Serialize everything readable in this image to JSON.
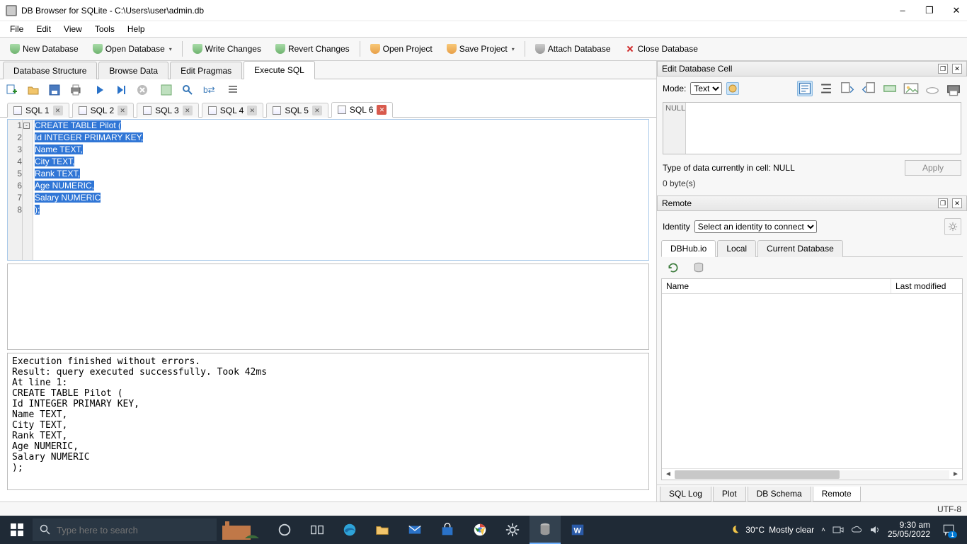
{
  "window": {
    "title": "DB Browser for SQLite - C:\\Users\\user\\admin.db"
  },
  "menu": {
    "file": "File",
    "edit": "Edit",
    "view": "View",
    "tools": "Tools",
    "help": "Help"
  },
  "toolbar": {
    "new_db": "New Database",
    "open_db": "Open Database",
    "write": "Write Changes",
    "revert": "Revert Changes",
    "open_project": "Open Project",
    "save_project": "Save Project",
    "attach": "Attach Database",
    "close": "Close Database"
  },
  "main_tabs": {
    "structure": "Database Structure",
    "browse": "Browse Data",
    "pragmas": "Edit Pragmas",
    "execute": "Execute SQL"
  },
  "sql_tabs": [
    "SQL 1",
    "SQL 2",
    "SQL 3",
    "SQL 4",
    "SQL 5",
    "SQL 6"
  ],
  "editor": {
    "line_numbers": [
      "1",
      "2",
      "3",
      "4",
      "5",
      "6",
      "7",
      "8"
    ],
    "lines_html": [
      "<span class='s-kw'>CREATE</span> <span class='s-kw'>TABLE</span> <span class='s-id'>Pilot</span> <span class='s-pu'>(</span>",
      "<span class='s-id'>Id</span> <span class='s-ty'>INTEGER</span> <span class='s-kw'>PRIMARY</span> <span class='s-kw'>KEY</span><span class='s-pu'>,</span>",
      "<span class='s-id'>Name</span> <span class='s-ty'>TEXT</span><span class='s-pu'>,</span>",
      "<span class='s-id'>City</span> <span class='s-ty'>TEXT</span><span class='s-pu'>,</span>",
      "<span class='s-id'>Rank</span> <span class='s-ty'>TEXT</span><span class='s-pu'>,</span>",
      "<span class='s-id'>Age</span> <span class='s-ty'>NUMERIC</span><span class='s-pu'>,</span>",
      "<span class='s-id'>Salary</span> <span class='s-ty'>NUMERIC</span>",
      "<span class='s-pu'>);</span>"
    ],
    "lines_plain": [
      "CREATE TABLE Pilot (",
      "Id INTEGER PRIMARY KEY,",
      "Name TEXT,",
      "City TEXT,",
      "Rank TEXT,",
      "Age NUMERIC,",
      "Salary NUMERIC",
      ");"
    ]
  },
  "output": "Execution finished without errors.\nResult: query executed successfully. Took 42ms\nAt line 1:\nCREATE TABLE Pilot (\nId INTEGER PRIMARY KEY,\nName TEXT,\nCity TEXT,\nRank TEXT,\nAge NUMERIC,\nSalary NUMERIC\n);",
  "edit_cell": {
    "title": "Edit Database Cell",
    "mode_label": "Mode:",
    "mode_value": "Text",
    "null": "NULL",
    "type_info": "Type of data currently in cell: NULL",
    "size": "0 byte(s)",
    "apply": "Apply"
  },
  "remote": {
    "title": "Remote",
    "identity_label": "Identity",
    "identity_value": "Select an identity to connect",
    "tabs": {
      "dbhub": "DBHub.io",
      "local": "Local",
      "current": "Current Database"
    },
    "cols": {
      "name": "Name",
      "modified": "Last modified"
    }
  },
  "bottom_tabs": {
    "sqllog": "SQL Log",
    "plot": "Plot",
    "schema": "DB Schema",
    "remote": "Remote"
  },
  "status": {
    "encoding": "UTF-8"
  },
  "taskbar": {
    "search_placeholder": "Type here to search",
    "weather_temp": "30°C",
    "weather_desc": "Mostly clear",
    "time": "9:30 am",
    "date": "25/05/2022",
    "notif_count": "1"
  }
}
